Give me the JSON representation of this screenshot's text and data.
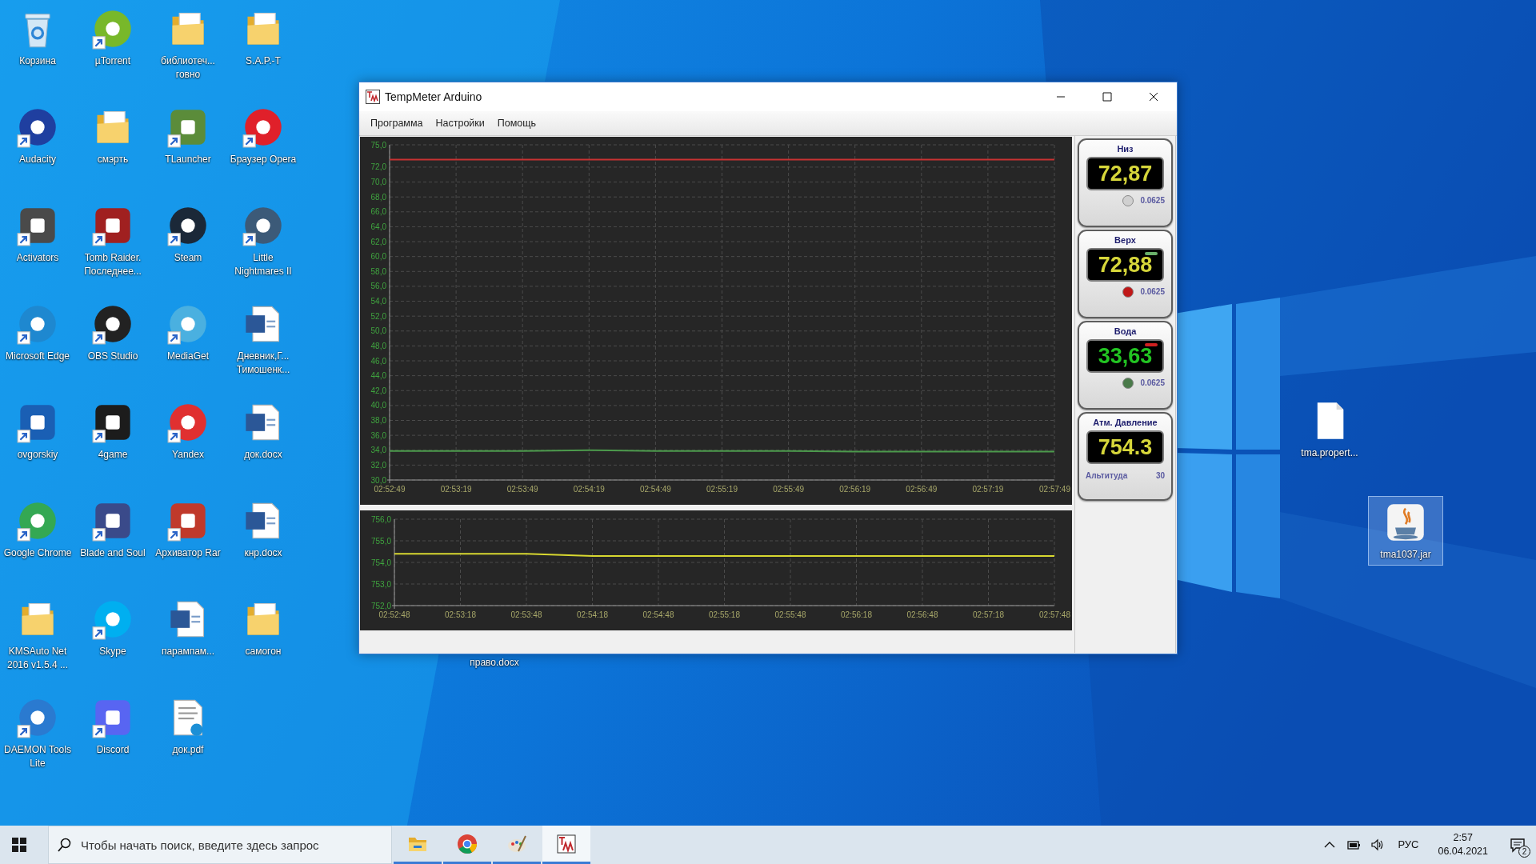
{
  "desktop_icons": [
    {
      "label": "Корзина",
      "kind": "bin",
      "shortcut": false,
      "selected": false
    },
    {
      "label": "µTorrent",
      "kind": "round",
      "color": "#78b82a",
      "shortcut": true,
      "selected": false
    },
    {
      "label": "библиотеч... говно",
      "kind": "folder",
      "shortcut": false,
      "selected": false
    },
    {
      "label": "S.A.P.-T",
      "kind": "folder",
      "shortcut": false,
      "selected": false
    },
    {
      "label": "Audacity",
      "kind": "round",
      "color": "#1f3fa0",
      "shortcut": true,
      "selected": false
    },
    {
      "label": "смэрть",
      "kind": "folder",
      "shortcut": false,
      "selected": false
    },
    {
      "label": "TLauncher",
      "kind": "square",
      "color": "#5b8c3a",
      "shortcut": true,
      "selected": false
    },
    {
      "label": "Браузер Opera",
      "kind": "round",
      "color": "#e0202a",
      "shortcut": true,
      "selected": false
    },
    {
      "label": "Activators",
      "kind": "square",
      "color": "#4a4a4a",
      "shortcut": true,
      "selected": false
    },
    {
      "label": "Tomb Raider. Последнее...",
      "kind": "square",
      "color": "#a02020",
      "shortcut": true,
      "selected": false
    },
    {
      "label": "Steam",
      "kind": "round",
      "color": "#1b2838",
      "shortcut": true,
      "selected": false
    },
    {
      "label": "Little Nightmares II",
      "kind": "round",
      "color": "#3c5a78",
      "shortcut": true,
      "selected": false
    },
    {
      "label": "Microsoft Edge",
      "kind": "round",
      "color": "#1e88d0",
      "shortcut": true,
      "selected": false
    },
    {
      "label": "OBS Studio",
      "kind": "round",
      "color": "#222222",
      "shortcut": true,
      "selected": false
    },
    {
      "label": "MediaGet",
      "kind": "round",
      "color": "#4ab0e0",
      "shortcut": true,
      "selected": false
    },
    {
      "label": "Дневник,Г... Тимошенк...",
      "kind": "word",
      "shortcut": false,
      "selected": false
    },
    {
      "label": "ovgorskiy",
      "kind": "square",
      "color": "#1a5fb4",
      "shortcut": true,
      "selected": false
    },
    {
      "label": "4game",
      "kind": "square",
      "color": "#1c1c1c",
      "shortcut": true,
      "selected": false
    },
    {
      "label": "Yandex",
      "kind": "round",
      "color": "#e03030",
      "shortcut": true,
      "selected": false
    },
    {
      "label": "док.docx",
      "kind": "word",
      "shortcut": false,
      "selected": false
    },
    {
      "label": "Google Chrome",
      "kind": "round",
      "color": "#34a853",
      "shortcut": true,
      "selected": false
    },
    {
      "label": "Blade and Soul",
      "kind": "square",
      "color": "#3a4a8a",
      "shortcut": true,
      "selected": false
    },
    {
      "label": "Архиватор Rar",
      "kind": "square",
      "color": "#c0392b",
      "shortcut": true,
      "selected": false
    },
    {
      "label": "кнр.docx",
      "kind": "word",
      "shortcut": false,
      "selected": false
    },
    {
      "label": "KMSAuto Net 2016 v1.5.4 ...",
      "kind": "folder",
      "shortcut": false,
      "selected": false
    },
    {
      "label": "Skype",
      "kind": "round",
      "color": "#00aff0",
      "shortcut": true,
      "selected": false
    },
    {
      "label": "парампам...",
      "kind": "word",
      "shortcut": false,
      "selected": false
    },
    {
      "label": "самогон",
      "kind": "folder",
      "shortcut": false,
      "selected": false
    },
    {
      "label": "DAEMON Tools Lite",
      "kind": "round",
      "color": "#2a7ad0",
      "shortcut": true,
      "selected": false
    },
    {
      "label": "Discord",
      "kind": "square",
      "color": "#5865f2",
      "shortcut": true,
      "selected": false
    },
    {
      "label": "док.pdf",
      "kind": "pdf",
      "shortcut": false,
      "selected": false
    }
  ],
  "loose_icons": [
    {
      "label": "tma.propert...",
      "kind": "file",
      "selected": false
    },
    {
      "label": "tma1037.jar",
      "kind": "java",
      "selected": true
    },
    {
      "label": "право.docx",
      "kind": "covered",
      "selected": false
    }
  ],
  "window": {
    "title": "TempMeter Arduino",
    "menu": [
      "Программа",
      "Настройки",
      "Помощь"
    ],
    "temperature_chart": {
      "chart_data": {
        "type": "line",
        "categories": [
          "02:52:49",
          "02:53:19",
          "02:53:49",
          "02:54:19",
          "02:54:49",
          "02:55:19",
          "02:55:49",
          "02:56:19",
          "02:56:49",
          "02:57:19",
          "02:57:49"
        ],
        "grid": true,
        "series": [
          {
            "color": "#c83232",
            "values": [
              73.0,
              73.0,
              73.0,
              73.0,
              73.0,
              73.0,
              73.0,
              73.0,
              73.0,
              73.0,
              73.0
            ]
          },
          {
            "color": "#4c9a4c",
            "values": [
              33.9,
              33.9,
              33.9,
              34.0,
              33.9,
              33.9,
              33.9,
              33.8,
              33.8,
              33.8,
              33.8
            ]
          }
        ],
        "ylim": [
          30,
          75
        ],
        "yticks": [
          {
            "value": 30,
            "label": "30,0"
          },
          {
            "value": 32,
            "label": "32,0"
          },
          {
            "value": 34,
            "label": "34,0"
          },
          {
            "value": 36,
            "label": "36,0"
          },
          {
            "value": 38,
            "label": "38,0"
          },
          {
            "value": 40,
            "label": "40,0"
          },
          {
            "value": 42,
            "label": "42,0"
          },
          {
            "value": 44,
            "label": "44,0"
          },
          {
            "value": 46,
            "label": "46,0"
          },
          {
            "value": 48,
            "label": "48,0"
          },
          {
            "value": 50,
            "label": "50,0"
          },
          {
            "value": 52,
            "label": "52,0"
          },
          {
            "value": 54,
            "label": "54,0"
          },
          {
            "value": 56,
            "label": "56,0"
          },
          {
            "value": 58,
            "label": "58,0"
          },
          {
            "value": 60,
            "label": "60,0"
          },
          {
            "value": 62,
            "label": "62,0"
          },
          {
            "value": 64,
            "label": "64,0"
          },
          {
            "value": 66,
            "label": "66,0"
          },
          {
            "value": 68,
            "label": "68,0"
          },
          {
            "value": 70,
            "label": "70,0"
          },
          {
            "value": 72,
            "label": "72,0"
          },
          {
            "value": 75,
            "label": "75,0"
          }
        ]
      }
    },
    "pressure_chart": {
      "chart_data": {
        "type": "line",
        "categories": [
          "02:52:48",
          "02:53:18",
          "02:53:48",
          "02:54:18",
          "02:54:48",
          "02:55:18",
          "02:55:48",
          "02:56:18",
          "02:56:48",
          "02:57:18",
          "02:57:48"
        ],
        "grid": true,
        "series": [
          {
            "color": "#d8d830",
            "values": [
              754.4,
              754.4,
              754.4,
              754.3,
              754.3,
              754.3,
              754.3,
              754.3,
              754.3,
              754.3,
              754.3
            ]
          }
        ],
        "ylim": [
          752,
          756
        ],
        "yticks": [
          {
            "value": 752,
            "label": "752,0"
          },
          {
            "value": 753,
            "label": "753,0"
          },
          {
            "value": 754,
            "label": "754,0"
          },
          {
            "value": 755,
            "label": "755,0"
          },
          {
            "value": 756,
            "label": "756,0"
          }
        ]
      }
    },
    "gauges": [
      {
        "kind": "sensor",
        "title": "Низ",
        "display": {
          "value": "72,87",
          "color": "#d6d63a"
        },
        "color": "#d0d0d0",
        "step": "0.0625"
      },
      {
        "kind": "sensor",
        "title": "Верх",
        "display": {
          "value": "72,88",
          "color": "#d6d63a"
        },
        "indicator": {
          "color": "#6ab06a"
        },
        "color": "#c01818",
        "step": "0.0625"
      },
      {
        "kind": "sensor",
        "title": "Вода",
        "display": {
          "value": "33,63",
          "color": "#22c422"
        },
        "indicator": {
          "color": "#d02020"
        },
        "color": "#4a7a4a",
        "step": "0.0625"
      },
      {
        "kind": "pressure",
        "title": "Атм. Давление",
        "display": {
          "value": "754.3",
          "color": "#d6d63a"
        },
        "footer_label": "Альтитуда",
        "footer_value": "30"
      }
    ]
  },
  "taskbar": {
    "search": {
      "placeholder": "Чтобы начать поиск, введите здесь запрос"
    },
    "apps": [
      {
        "kind": "explorer",
        "running": true,
        "selected": false
      },
      {
        "kind": "chrome",
        "running": true,
        "selected": false
      },
      {
        "kind": "paint",
        "running": true,
        "selected": false
      },
      {
        "kind": "tma",
        "running": true,
        "selected": true
      }
    ],
    "tray": {
      "language": "РУС",
      "time": "2:57",
      "date": "06.04.2021",
      "notifications": "2"
    }
  }
}
